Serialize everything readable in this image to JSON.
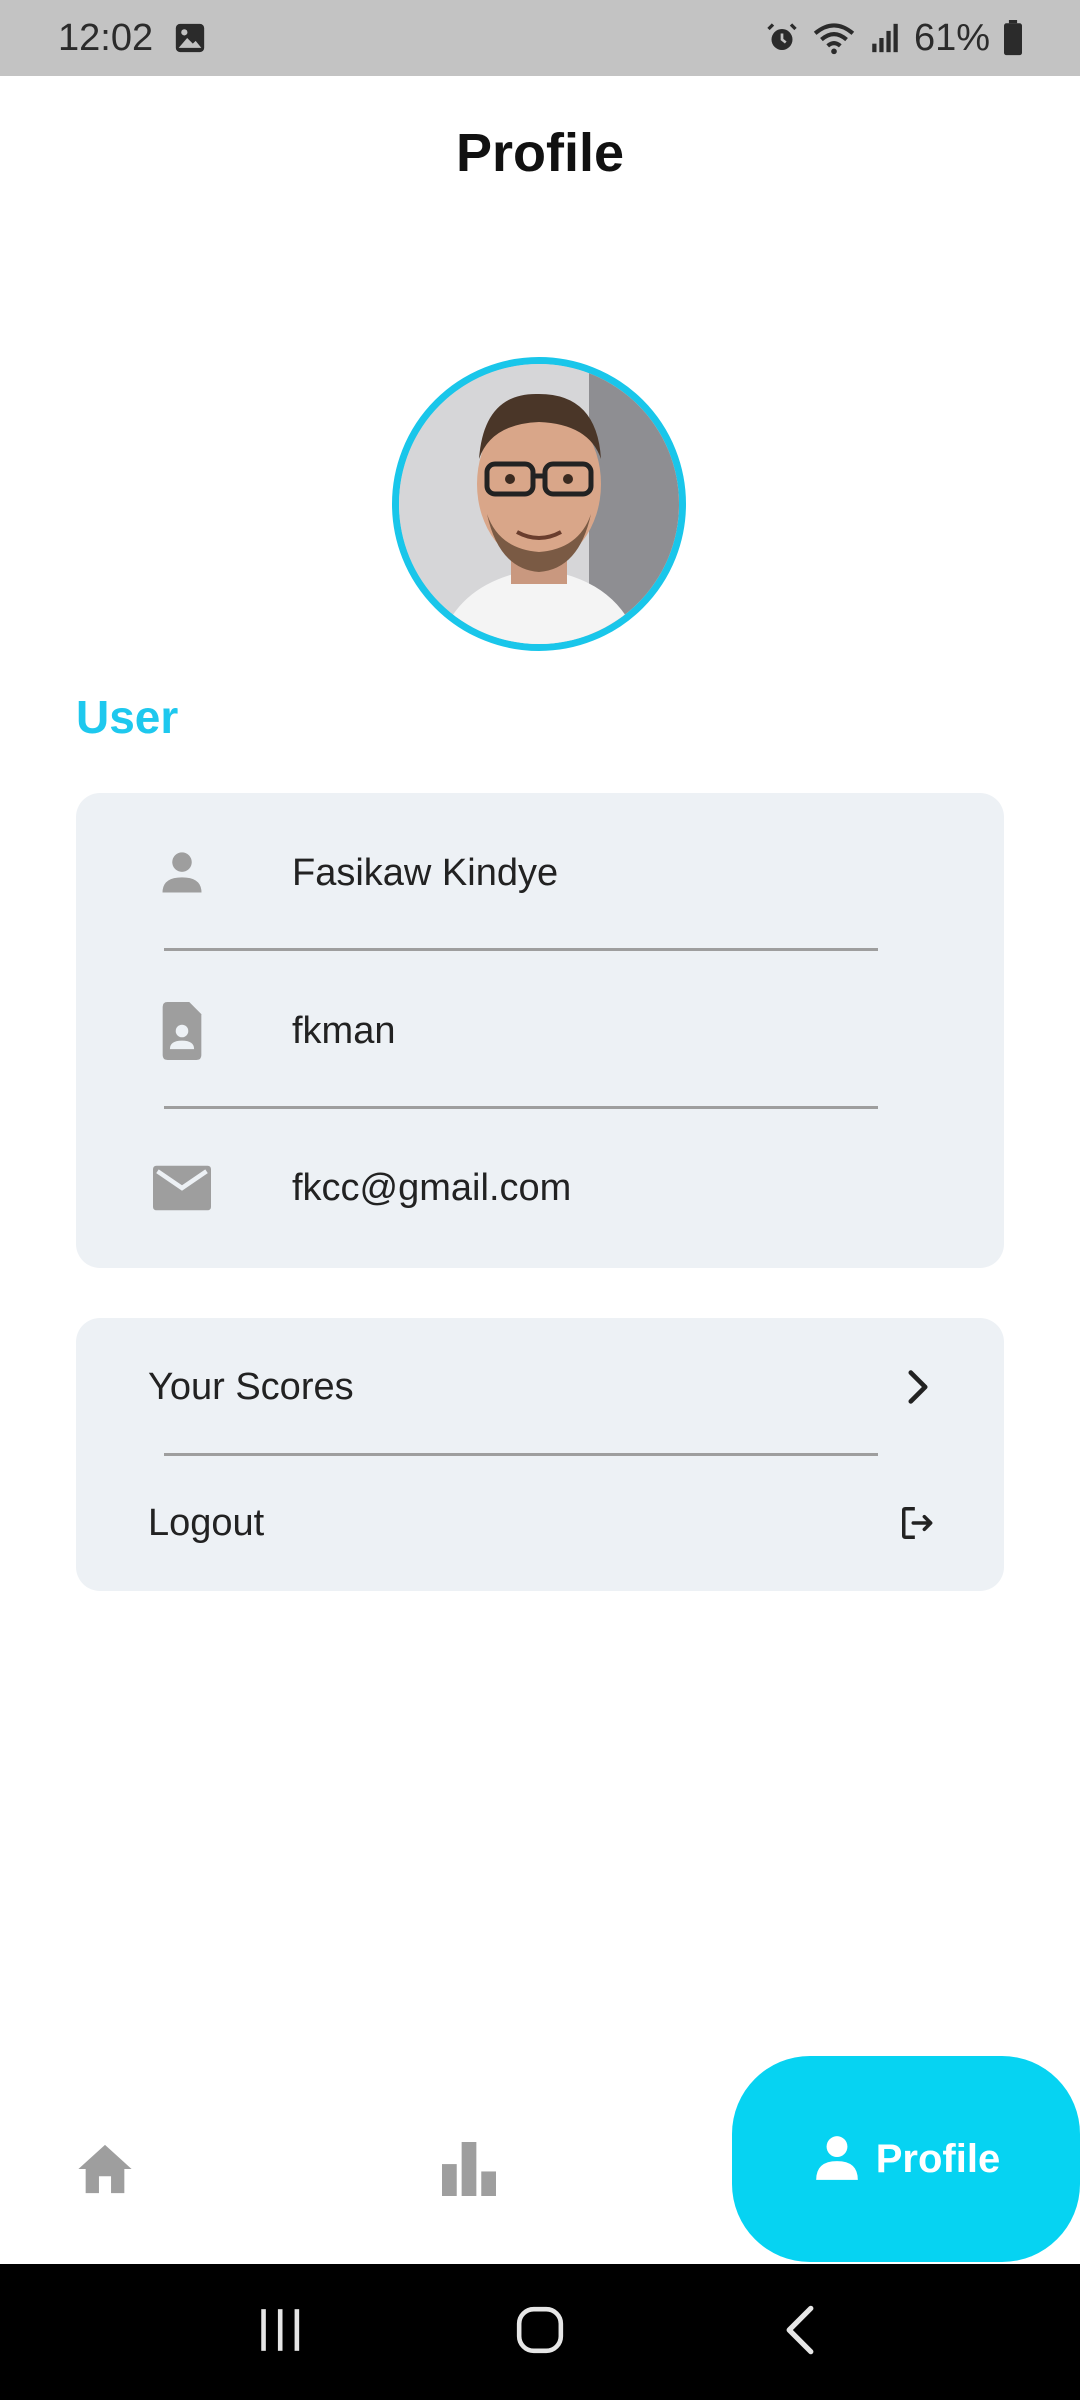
{
  "status_bar": {
    "time": "12:02",
    "battery": "61%"
  },
  "header": {
    "title": "Profile"
  },
  "section": {
    "label": "User"
  },
  "user_info": [
    {
      "icon": "person-icon",
      "value": "Fasikaw Kindye"
    },
    {
      "icon": "contact-file-icon",
      "value": "fkman"
    },
    {
      "icon": "mail-icon",
      "value": "fkcc@gmail.com"
    }
  ],
  "actions": [
    {
      "label": "Your Scores",
      "icon": "chevron-right-icon"
    },
    {
      "label": "Logout",
      "icon": "logout-icon"
    }
  ],
  "bottom_nav": {
    "items": [
      {
        "icon": "home-icon",
        "label": ""
      },
      {
        "icon": "bar-chart-icon",
        "label": ""
      },
      {
        "icon": "person-icon",
        "label": "Profile",
        "active": true
      }
    ]
  },
  "colors": {
    "accent": "#06d3f2",
    "section_label": "#1ec8ee",
    "card_bg": "#edf1f5",
    "icon_gray": "#9e9e9e"
  }
}
